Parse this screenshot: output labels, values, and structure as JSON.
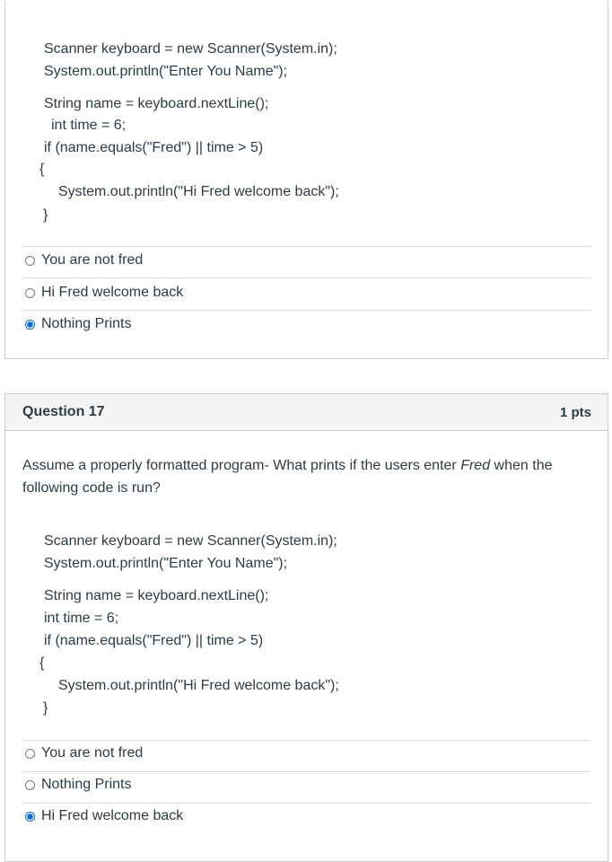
{
  "q16": {
    "code": [
      "Scanner keyboard = new Scanner(System.in);",
      "System.out.println(\"Enter You Name\");",
      "String name = keyboard.nextLine();",
      "int time = 6;",
      "if (name.equals(\"Fred\") || time > 5)",
      "{",
      "System.out.println(\"Hi Fred welcome back\");",
      "}"
    ],
    "options": [
      {
        "label": "You are not fred",
        "selected": false
      },
      {
        "label": "Hi Fred welcome back",
        "selected": false
      },
      {
        "label": "Nothing Prints",
        "selected": true
      }
    ]
  },
  "q17": {
    "title": "Question 17",
    "points": "1 pts",
    "question_pre": "Assume a properly formatted program- What prints if the users enter ",
    "question_em": "Fred",
    "question_post": " when the following code is run?",
    "code": [
      "Scanner keyboard = new Scanner(System.in);",
      "System.out.println(\"Enter You Name\");",
      "String name = keyboard.nextLine();",
      "int time = 6;",
      "if (name.equals(\"Fred\") || time > 5)",
      "{",
      "System.out.println(\"Hi Fred welcome back\");",
      "}"
    ],
    "options": [
      {
        "label": "You are not fred",
        "selected": false
      },
      {
        "label": "Nothing Prints",
        "selected": false
      },
      {
        "label": "Hi Fred welcome back",
        "selected": true
      }
    ]
  },
  "accent": "#0b6ad8"
}
